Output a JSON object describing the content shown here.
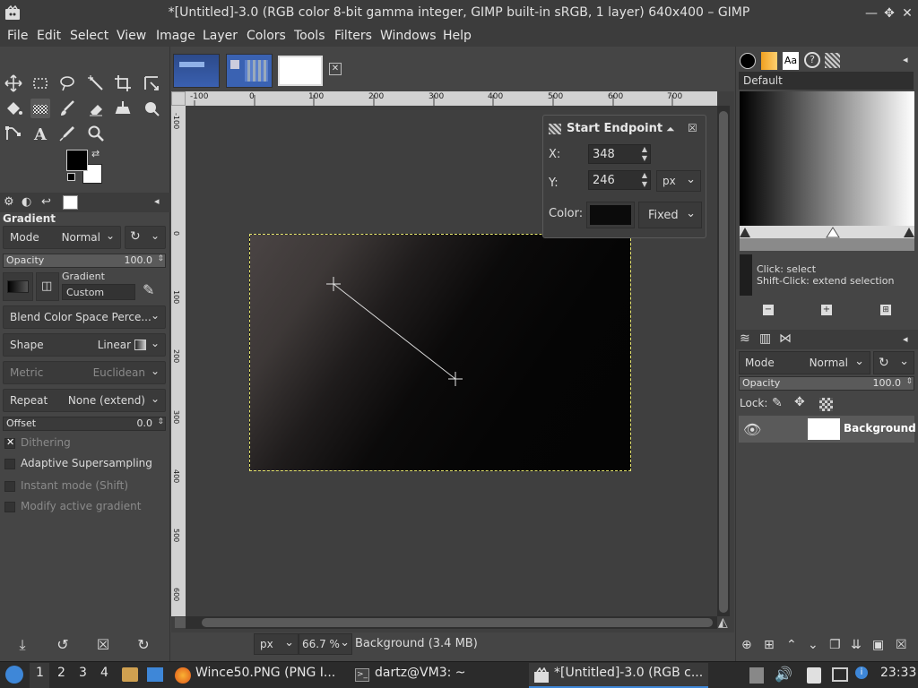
{
  "window": {
    "title": "*[Untitled]-3.0 (RGB color 8-bit gamma integer, GIMP built-in sRGB, 1 layer) 640x400 – GIMP"
  },
  "menu": [
    "File",
    "Edit",
    "Select",
    "View",
    "Image",
    "Layer",
    "Colors",
    "Tools",
    "Filters",
    "Windows",
    "Help"
  ],
  "tool_options": {
    "title": "Gradient",
    "mode_label": "Mode",
    "mode_value": "Normal",
    "opacity_label": "Opacity",
    "opacity_value": "100.0",
    "gradient_label": "Gradient",
    "gradient_name": "Custom",
    "blend_space": "Blend Color Space Perce...",
    "shape_label": "Shape",
    "shape_value": "Linear",
    "metric_label": "Metric",
    "metric_value": "Euclidean",
    "repeat_label": "Repeat",
    "repeat_value": "None (extend)",
    "offset_label": "Offset",
    "offset_value": "0.0",
    "checks": [
      {
        "label": "Dithering",
        "checked": true
      },
      {
        "label": "Adaptive Supersampling",
        "checked": false
      },
      {
        "label": "Instant mode  (Shift)",
        "checked": false
      },
      {
        "label": "Modify active gradient",
        "checked": false
      }
    ]
  },
  "ruler": {
    "h_ticks": [
      "-100",
      "0",
      "100",
      "200",
      "300",
      "400",
      "500",
      "600",
      "700"
    ],
    "v_ticks": [
      "-100",
      "0",
      "100",
      "200",
      "300",
      "400",
      "500",
      "600"
    ]
  },
  "endpoint": {
    "title": "Start Endpoint",
    "x_label": "X:",
    "x_value": "348",
    "y_label": "Y:",
    "y_value": "246",
    "unit": "px",
    "color_label": "Color:",
    "color_mode": "Fixed"
  },
  "statusbar": {
    "unit": "px",
    "zoom": "66.7 %",
    "info": "Background (3.4 MB)"
  },
  "gradient_editor": {
    "name": "Default",
    "hint_line1": "Click: select",
    "hint_line2": "Shift-Click: extend selection"
  },
  "layers": {
    "mode_label": "Mode",
    "mode_value": "Normal",
    "opacity_label": "Opacity",
    "opacity_value": "100.0",
    "lock_label": "Lock:",
    "items": [
      {
        "name": "Background",
        "visible": true
      }
    ]
  },
  "taskbar": {
    "workspaces": [
      "1",
      "2",
      "3",
      "4"
    ],
    "tasks": [
      "Wince50.PNG (PNG I...",
      "dartz@VM3: ~",
      "*[Untitled]-3.0 (RGB c..."
    ],
    "clock": "23:33"
  },
  "colors": {
    "fg": "#000000",
    "bg": "#ffffff",
    "accent": "#3e87d8"
  }
}
